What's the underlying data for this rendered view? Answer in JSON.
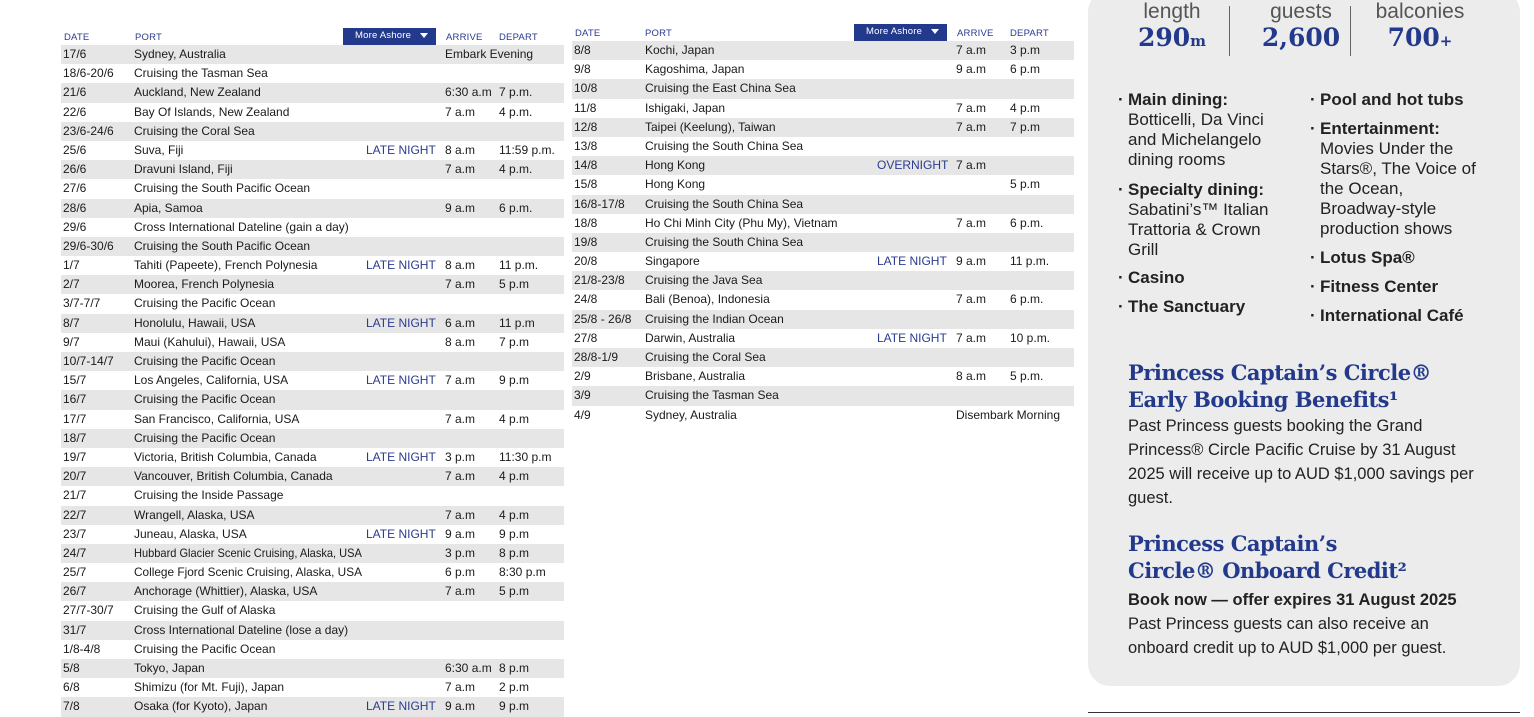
{
  "headers": {
    "date": "DATE",
    "port": "PORT",
    "more_ashore": "More Ashore",
    "arrive": "ARRIVE",
    "depart": "DEPART"
  },
  "left_rows": [
    {
      "date": "17/6",
      "port": "Sydney, Australia",
      "note": "",
      "arrive": "Embark Evening",
      "depart": ""
    },
    {
      "date": "18/6-20/6",
      "port": "Cruising the Tasman Sea",
      "note": "",
      "arrive": "",
      "depart": ""
    },
    {
      "date": "21/6",
      "port": "Auckland, New Zealand",
      "note": "",
      "arrive": "6:30 a.m",
      "depart": "7 p.m."
    },
    {
      "date": "22/6",
      "port": "Bay Of Islands, New Zealand",
      "note": "",
      "arrive": "7 a.m",
      "depart": "4 p.m."
    },
    {
      "date": "23/6-24/6",
      "port": "Cruising the Coral Sea",
      "note": "",
      "arrive": "",
      "depart": ""
    },
    {
      "date": "25/6",
      "port": "Suva, Fiji",
      "note": "LATE NIGHT",
      "arrive": "8 a.m",
      "depart": "11:59 p.m."
    },
    {
      "date": "26/6",
      "port": "Dravuni Island, Fiji",
      "note": "",
      "arrive": "7 a.m",
      "depart": "4 p.m."
    },
    {
      "date": "27/6",
      "port": "Cruising the South Pacific Ocean",
      "note": "",
      "arrive": "",
      "depart": ""
    },
    {
      "date": "28/6",
      "port": "Apia, Samoa",
      "note": "",
      "arrive": "9 a.m",
      "depart": "6 p.m."
    },
    {
      "date": "29/6",
      "port": "Cross International Dateline (gain a day)",
      "note": "",
      "arrive": "",
      "depart": ""
    },
    {
      "date": "29/6-30/6",
      "port": "Cruising the South Pacific Ocean",
      "note": "",
      "arrive": "",
      "depart": ""
    },
    {
      "date": "1/7",
      "port": "Tahiti (Papeete), French Polynesia",
      "note": "LATE NIGHT",
      "arrive": "8 a.m",
      "depart": "11 p.m."
    },
    {
      "date": "2/7",
      "port": "Moorea, French Polynesia",
      "note": "",
      "arrive": "7 a.m",
      "depart": "5 p.m"
    },
    {
      "date": "3/7-7/7",
      "port": "Cruising the Pacific Ocean",
      "note": "",
      "arrive": "",
      "depart": ""
    },
    {
      "date": "8/7",
      "port": "Honolulu, Hawaii, USA",
      "note": "LATE NIGHT",
      "arrive": "6 a.m",
      "depart": "11 p.m"
    },
    {
      "date": "9/7",
      "port": "Maui (Kahului), Hawaii, USA",
      "note": "",
      "arrive": "8 a.m",
      "depart": "7 p.m"
    },
    {
      "date": "10/7-14/7",
      "port": "Cruising the Pacific Ocean",
      "note": "",
      "arrive": "",
      "depart": ""
    },
    {
      "date": "15/7",
      "port": "Los Angeles, California, USA",
      "note": "LATE NIGHT",
      "arrive": "7 a.m",
      "depart": "9 p.m"
    },
    {
      "date": "16/7",
      "port": "Cruising the Pacific Ocean",
      "note": "",
      "arrive": "",
      "depart": ""
    },
    {
      "date": "17/7",
      "port": "San Francisco, California, USA",
      "note": "",
      "arrive": "7 a.m",
      "depart": "4 p.m"
    },
    {
      "date": "18/7",
      "port": "Cruising the Pacific Ocean",
      "note": "",
      "arrive": "",
      "depart": ""
    },
    {
      "date": "19/7",
      "port": "Victoria, British Columbia, Canada",
      "note": "LATE NIGHT",
      "arrive": "3 p.m",
      "depart": "11:30 p.m"
    },
    {
      "date": "20/7",
      "port": "Vancouver, British Columbia, Canada",
      "note": "",
      "arrive": "7 a.m",
      "depart": "4 p.m"
    },
    {
      "date": "21/7",
      "port": "Cruising the Inside Passage",
      "note": "",
      "arrive": "",
      "depart": ""
    },
    {
      "date": "22/7",
      "port": "Wrangell, Alaska, USA",
      "note": "",
      "arrive": "7 a.m",
      "depart": "4 p.m"
    },
    {
      "date": "23/7",
      "port": "Juneau, Alaska, USA",
      "note": "LATE NIGHT",
      "arrive": "9 a.m",
      "depart": "9 p.m"
    },
    {
      "date": "24/7",
      "port": "Hubbard Glacier Scenic Cruising, Alaska, USA",
      "note": "",
      "arrive": "3 p.m",
      "depart": "8 p.m"
    },
    {
      "date": "25/7",
      "port": "College Fjord Scenic Cruising, Alaska, USA",
      "note": "",
      "arrive": "6 p.m",
      "depart": "8:30 p.m"
    },
    {
      "date": "26/7",
      "port": "Anchorage (Whittier), Alaska, USA",
      "note": "",
      "arrive": "7 a.m",
      "depart": "5 p.m"
    },
    {
      "date": "27/7-30/7",
      "port": "Cruising the Gulf of Alaska",
      "note": "",
      "arrive": "",
      "depart": ""
    },
    {
      "date": "31/7",
      "port": "Cross International Dateline (lose a day)",
      "note": "",
      "arrive": "",
      "depart": ""
    },
    {
      "date": "1/8-4/8",
      "port": "Cruising the Pacific Ocean",
      "note": "",
      "arrive": "",
      "depart": ""
    },
    {
      "date": "5/8",
      "port": "Tokyo, Japan",
      "note": "",
      "arrive": "6:30 a.m",
      "depart": "8 p.m"
    },
    {
      "date": "6/8",
      "port": "Shimizu (for Mt. Fuji), Japan",
      "note": "",
      "arrive": "7 a.m",
      "depart": "2 p.m"
    },
    {
      "date": "7/8",
      "port": "Osaka (for Kyoto), Japan",
      "note": "LATE NIGHT",
      "arrive": "9 a.m",
      "depart": "9 p.m"
    }
  ],
  "right_rows": [
    {
      "date": "8/8",
      "port": "Kochi, Japan",
      "note": "",
      "arrive": "7 a.m",
      "depart": "3 p.m"
    },
    {
      "date": "9/8",
      "port": "Kagoshima, Japan",
      "note": "",
      "arrive": "9 a.m",
      "depart": "6 p.m"
    },
    {
      "date": "10/8",
      "port": "Cruising the East China Sea",
      "note": "",
      "arrive": "",
      "depart": ""
    },
    {
      "date": "11/8",
      "port": "Ishigaki, Japan",
      "note": "",
      "arrive": "7 a.m",
      "depart": "4 p.m"
    },
    {
      "date": "12/8",
      "port": "Taipei (Keelung), Taiwan",
      "note": "",
      "arrive": "7 a.m",
      "depart": "7 p.m"
    },
    {
      "date": "13/8",
      "port": "Cruising the South China Sea",
      "note": "",
      "arrive": "",
      "depart": ""
    },
    {
      "date": "14/8",
      "port": "Hong Kong",
      "note": "OVERNIGHT",
      "arrive": "7 a.m",
      "depart": ""
    },
    {
      "date": "15/8",
      "port": "Hong Kong",
      "note": "",
      "arrive": "",
      "depart": "5 p.m"
    },
    {
      "date": "16/8-17/8",
      "port": "Cruising the South China Sea",
      "note": "",
      "arrive": "",
      "depart": ""
    },
    {
      "date": "18/8",
      "port": "Ho Chi  Minh City  (Phu My), Vietnam",
      "note": "",
      "arrive": "7 a.m",
      "depart": "6 p.m."
    },
    {
      "date": "19/8",
      "port": "Cruising the South China Sea",
      "note": "",
      "arrive": "",
      "depart": ""
    },
    {
      "date": "20/8",
      "port": "Singapore",
      "note": "LATE NIGHT",
      "arrive": "9 a.m",
      "depart": "11 p.m."
    },
    {
      "date": "21/8-23/8",
      "port": "Cruising the Java Sea",
      "note": "",
      "arrive": "",
      "depart": ""
    },
    {
      "date": "24/8",
      "port": "Bali (Benoa), Indonesia",
      "note": "",
      "arrive": "7 a.m",
      "depart": "6 p.m."
    },
    {
      "date": "25/8 - 26/8",
      "port": "Cruising the Indian Ocean",
      "note": "",
      "arrive": "",
      "depart": ""
    },
    {
      "date": "27/8",
      "port": "Darwin, Australia",
      "note": "LATE NIGHT",
      "arrive": "7 a.m",
      "depart": "10 p.m."
    },
    {
      "date": "28/8-1/9",
      "port": "Cruising the Coral Sea",
      "note": "",
      "arrive": "",
      "depart": ""
    },
    {
      "date": "2/9",
      "port": "Brisbane, Australia",
      "note": "",
      "arrive": "8 a.m",
      "depart": "5 p.m."
    },
    {
      "date": "3/9",
      "port": "Cruising the Tasman Sea",
      "note": "",
      "arrive": "",
      "depart": ""
    },
    {
      "date": "4/9",
      "port": "Sydney, Australia",
      "note": "",
      "arrive": "Disembark Morning",
      "depart": ""
    }
  ],
  "ship_stats": [
    {
      "label": "length",
      "value": "290",
      "unit": "m"
    },
    {
      "label": "guests",
      "value": "2,600",
      "unit": ""
    },
    {
      "label": "balconies",
      "value": "700",
      "unit": "+"
    }
  ],
  "features": {
    "main_dining_title": "Main dining:",
    "main_dining_text": "Botticelli,  Da Vinci and Michelangelo dining rooms",
    "specialty_title": "Specialty dining:",
    "specialty_text": "Sabatini’s™ Italian Trattoria & Crown Grill",
    "casino": "Casino",
    "sanctuary": "The Sanctuary",
    "pool": "Pool and hot tubs",
    "entertainment_title": "Entertainment:",
    "entertainment_text": "Movies Under the Stars®, The Voice of the Ocean, Broadway-style production shows",
    "lotus": "Lotus Spa®",
    "fitness": "Fitness Center",
    "cafe": "International Café"
  },
  "offers": {
    "early_title": "Princess Captain’s Circle® Early Booking Benefits¹",
    "early_text": "Past Princess guests booking the Grand Princess® Circle Pacific Cruise by 31 August 2025 will receive up to AUD $1,000 savings per guest.",
    "credit_title": "Princess Captain’s Circle® Onboard Credit²",
    "credit_bold": "Book now — offer expires 31 August 2025",
    "credit_text": "Past Princess guests can also receive an onboard credit up to AUD $1,000 per guest."
  },
  "colors": {
    "brand_blue": "#233a8c",
    "row_shade": "#e6e6e6",
    "panel_bg": "#ececec"
  }
}
